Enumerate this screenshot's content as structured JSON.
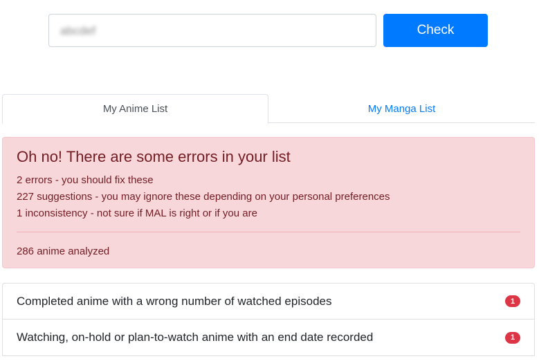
{
  "search": {
    "value": "abcdef",
    "button_label": "Check"
  },
  "tabs": [
    {
      "label": "My Anime List",
      "active": true
    },
    {
      "label": "My Manga List",
      "active": false
    }
  ],
  "alert": {
    "heading": "Oh no! There are some errors in your list",
    "lines": [
      "2 errors - you should fix these",
      "227 suggestions - you may ignore these depending on your personal preferences",
      "1 inconsistency - not sure if MAL is right or if you are"
    ],
    "footer": "286 anime analyzed"
  },
  "issues": [
    {
      "label": "Completed anime with a wrong number of watched episodes",
      "count": "1"
    },
    {
      "label": "Watching, on-hold or plan-to-watch anime with an end date recorded",
      "count": "1"
    }
  ],
  "colors": {
    "primary": "#007bff",
    "danger": "#dc3545",
    "alert_bg": "#f8d7da",
    "alert_text": "#721c24"
  }
}
